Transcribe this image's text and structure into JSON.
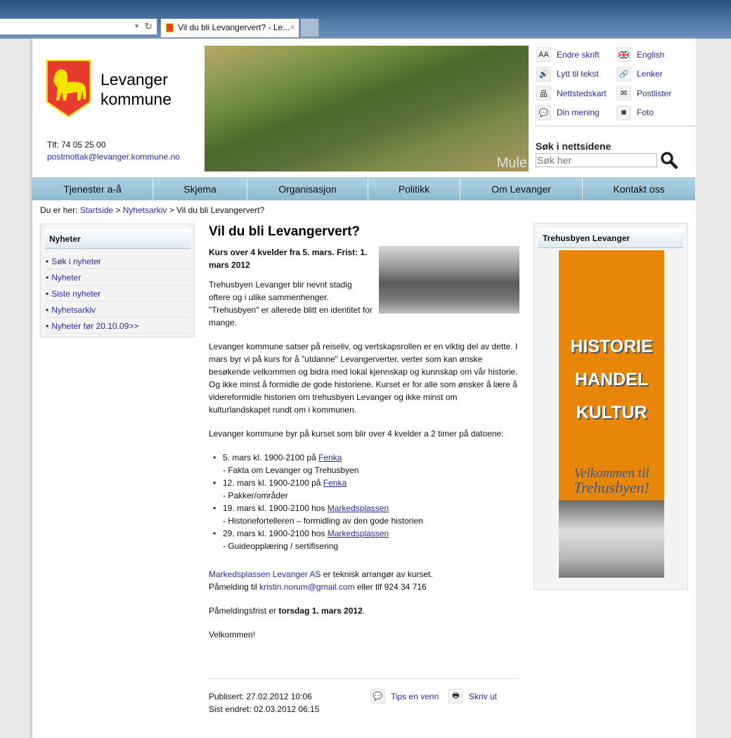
{
  "browser": {
    "tab_title": "Vil du bli Levangervert? - Le...",
    "close": "×"
  },
  "header": {
    "brand_line1": "Levanger",
    "brand_line2": "kommune",
    "phone": "Tlf: 74 05 25 00",
    "email": "postmottak@levanger.kommune.no",
    "hero_caption": "Mule"
  },
  "tools": [
    {
      "label": "Endre skrift",
      "icon": "text-size-icon",
      "glyph": "AA"
    },
    {
      "label": "English",
      "icon": "uk-flag-icon",
      "glyph": ""
    },
    {
      "label": "Lytt til tekst",
      "icon": "speaker-icon",
      "glyph": "🔊"
    },
    {
      "label": "Lenker",
      "icon": "link-icon",
      "glyph": "🔗"
    },
    {
      "label": "Nettstedskart",
      "icon": "sitemap-icon",
      "glyph": "品"
    },
    {
      "label": "Postlister",
      "icon": "envelope-icon",
      "glyph": "✉"
    },
    {
      "label": "Din mening",
      "icon": "speech-bubble-icon",
      "glyph": "💬"
    },
    {
      "label": "Foto",
      "icon": "camera-icon",
      "glyph": "◙"
    }
  ],
  "search": {
    "title": "Søk i nettsidene",
    "placeholder": "Søk her"
  },
  "nav": [
    "Tjenester a-å",
    "Skjema",
    "Organisasjon",
    "Politikk",
    "Om Levanger",
    "Kontakt oss"
  ],
  "breadcrumb": {
    "prefix": "Du er her: ",
    "items": [
      "Startside",
      "Nyhetsarkiv"
    ],
    "sep": " > ",
    "current": "Vil du bli Levangervert?"
  },
  "left": {
    "title": "Nyheter",
    "items": [
      "Søk i nyheter",
      "Nyheter",
      "Siste nyheter",
      "Nyhetsarkiv",
      "Nyheter før 20.10.09>>"
    ]
  },
  "article": {
    "title": "Vil du bli Levangervert?",
    "lead": "Kurs over 4 kvelder fra 5. mars. Frist: 1. mars 2012",
    "p1": "Trehusbyen Levanger blir nevnt stadig oftere og i ulike sammenhenger. \"Trehusbyen\" er allerede blitt en identitet for mange.",
    "p2": "Levanger kommune satser på reiseliv, og vertskapsrollen er en viktig del av dette. I mars byr vi på kurs for å \"utdanne\" Levangerverter, verter som kan ønske besøkende velkommen og bidra med lokal kjennskap og kunnskap om vår historie. Og ikke minst å formidle de gode historiene. Kurset er for alle som ønsker å lære å videreformidle historien om trehusbyen Levanger og ikke minst om kulturlandskapet rundt om i kommunen.",
    "p3": "Levanger kommune byr på kurset som blir over 4 kvelder a 2 timer på datoene:",
    "sessions": [
      {
        "text": "5. mars kl. 1900-2100 på ",
        "place": "Fenka",
        "topic": "- Fakta om Levanger og Trehusbyen"
      },
      {
        "text": "12. mars kl. 1900-2100 på ",
        "place": "Fenka",
        "topic": "- Pakker/områder"
      },
      {
        "text": "19. mars kl. 1900-2100 hos ",
        "place": "Markedsplassen",
        "topic": "- Historiefortelleren – formidling av den gode historien"
      },
      {
        "text": "29. mars kl. 1900-2100 hos ",
        "place": "Markedsplassen",
        "topic": "- Guideopplæring / sertifisering"
      }
    ],
    "org_link": "Markedsplassen Levanger AS",
    "org_text": " er teknisk arrangør av kurset.",
    "signup_prefix": "Påmelding til ",
    "signup_email": "kristin.norum@gmail.com",
    "signup_suffix": " eller tlf 924 34 716",
    "deadline_prefix": "Påmeldingsfrist er ",
    "deadline_bold": "torsdag 1. mars 2012",
    "deadline_suffix": ".",
    "closing": "Velkommen!",
    "published": "Publisert: 27.02.2012 10:06",
    "modified": "Sist endret: 02.03.2012 06:15",
    "tips": "Tips en venn",
    "print": "Skriv ut"
  },
  "right": {
    "title": "Trehusbyen Levanger",
    "banner": {
      "words": [
        "HISTORIE",
        "HANDEL",
        "KULTUR"
      ],
      "script1": "Velkommen til",
      "script2": "Trehusbyen!"
    }
  },
  "colors": {
    "nav": "#9cc6da",
    "link": "#2a2a9a",
    "banner": "#e8860a",
    "logo_red": "#e63b2e",
    "logo_yellow": "#f5d800"
  }
}
